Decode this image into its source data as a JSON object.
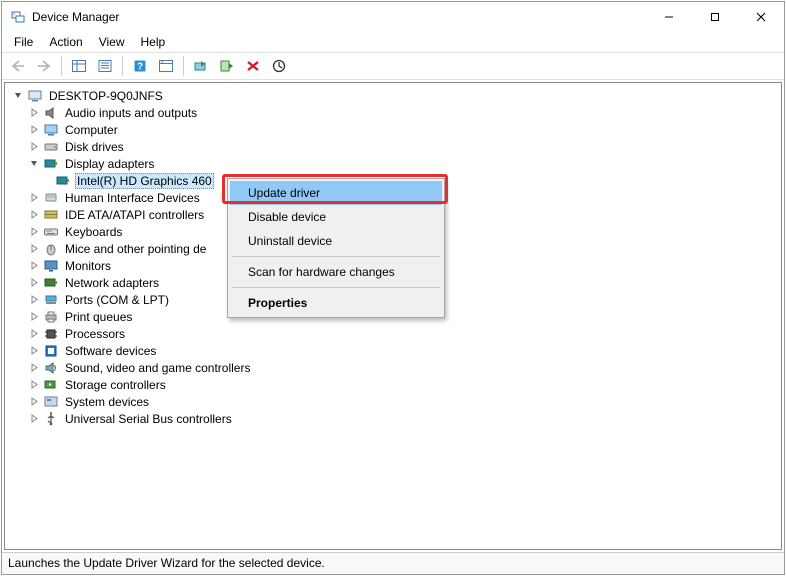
{
  "window": {
    "title": "Device Manager"
  },
  "menu": {
    "file": "File",
    "action": "Action",
    "view": "View",
    "help": "Help"
  },
  "tree": {
    "root": "DESKTOP-9Q0JNFS",
    "nodes": {
      "audio": "Audio inputs and outputs",
      "computer": "Computer",
      "disk": "Disk drives",
      "display": "Display adapters",
      "display_child": "Intel(R) HD Graphics 460",
      "hid": "Human Interface Devices",
      "ide": "IDE ATA/ATAPI controllers",
      "keyboards": "Keyboards",
      "mice": "Mice and other pointing de",
      "monitors": "Monitors",
      "network": "Network adapters",
      "ports": "Ports (COM & LPT)",
      "printq": "Print queues",
      "processors": "Processors",
      "software": "Software devices",
      "sound": "Sound, video and game controllers",
      "storage": "Storage controllers",
      "system": "System devices",
      "usb": "Universal Serial Bus controllers"
    }
  },
  "context_menu": {
    "update": "Update driver",
    "disable": "Disable device",
    "uninstall": "Uninstall device",
    "scan": "Scan for hardware changes",
    "properties": "Properties"
  },
  "status": "Launches the Update Driver Wizard for the selected device."
}
